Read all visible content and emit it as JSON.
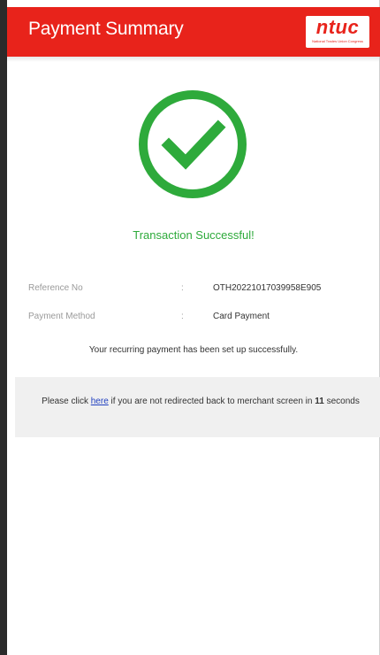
{
  "header": {
    "title": "Payment Summary",
    "logo_text": "ntuc",
    "logo_tagline": "National Trades Union Congress",
    "brand_color": "#e8231b"
  },
  "status": {
    "icon": "check-circle-icon",
    "message": "Transaction Successful!",
    "color": "#2eaa3b"
  },
  "details": {
    "separator": ":",
    "rows": [
      {
        "label": "Reference No",
        "value": "OTH20221017039958E905"
      },
      {
        "label": "Payment Method",
        "value": "Card Payment"
      }
    ]
  },
  "recurring_message": "Your recurring payment has been set up successfully.",
  "redirect": {
    "prefix": "Please click ",
    "link_text": "here",
    "middle": " if you are not redirected back to merchant screen in ",
    "seconds": "11",
    "suffix": " seconds"
  }
}
